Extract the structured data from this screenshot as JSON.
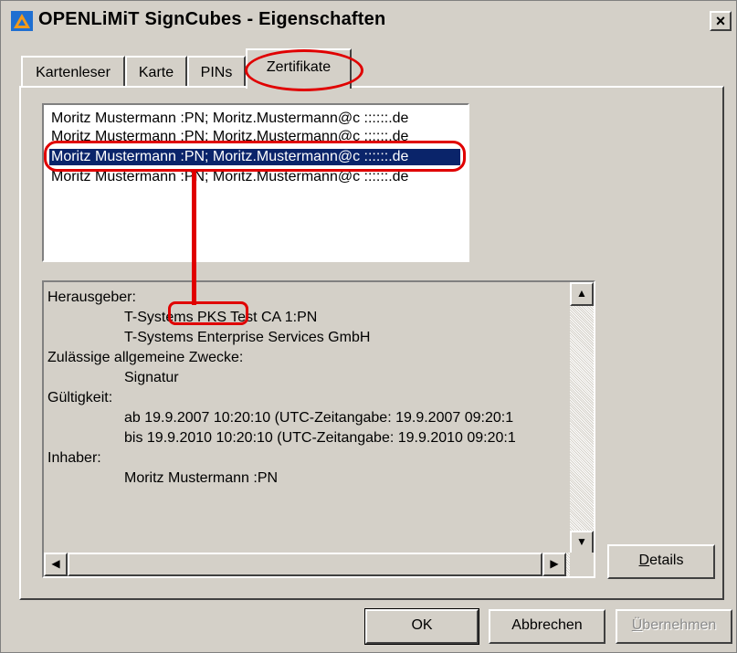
{
  "window": {
    "title": "OPENLiMiT SignCubes - Eigenschaften",
    "close_label": "×"
  },
  "tabs": [
    {
      "label": "Kartenleser",
      "active": false
    },
    {
      "label": "Karte",
      "active": false
    },
    {
      "label": "PINs",
      "active": false
    },
    {
      "label": "Zertifikate",
      "active": true
    }
  ],
  "certificates": [
    {
      "label": "Moritz Mustermann :PN; Moritz.Mustermann@c ::::::.de",
      "selected": false
    },
    {
      "label": "Moritz Mustermann :PN; Moritz.Mustermann@c ::::::.de",
      "selected": false
    },
    {
      "label": "Moritz Mustermann :PN; Moritz.Mustermann@c ::::::.de",
      "selected": true
    },
    {
      "label": "Moritz Mustermann :PN; Moritz.Mustermann@c ::::::.de",
      "selected": false
    }
  ],
  "details": {
    "lines": [
      {
        "text": "Herausgeber:",
        "indent": false
      },
      {
        "text": "T-Systems PKS Test CA 1:PN",
        "indent": true
      },
      {
        "text": "T-Systems Enterprise Services GmbH",
        "indent": true
      },
      {
        "text": "Zulässige allgemeine Zwecke:",
        "indent": false
      },
      {
        "text": "Signatur",
        "indent": true
      },
      {
        "text": "Gültigkeit:",
        "indent": false
      },
      {
        "text": "ab 19.9.2007 10:20:10 (UTC-Zeitangabe: 19.9.2007 09:20:1",
        "indent": true
      },
      {
        "text": "bis 19.9.2010 10:20:10 (UTC-Zeitangabe: 19.9.2010 09:20:1",
        "indent": true
      },
      {
        "text": "Inhaber:",
        "indent": false
      },
      {
        "text": "Moritz Mustermann :PN",
        "indent": true
      }
    ]
  },
  "buttons": {
    "details": {
      "label_u": "D",
      "label_rest": "etails"
    },
    "ok": "OK",
    "cancel": "Abbrechen",
    "apply": {
      "label_u": "Ü",
      "label_rest": "bernehmen",
      "disabled": true
    }
  },
  "scroll_glyphs": {
    "up": "▲",
    "down": "▼",
    "left": "◀",
    "right": "▶"
  },
  "colors": {
    "selection": "#0a246a",
    "annotation": "#e00000",
    "face": "#d4d0c8",
    "title_icon": "#1f6fd1"
  },
  "icons": {
    "title": "openlimit-triangle-icon"
  }
}
